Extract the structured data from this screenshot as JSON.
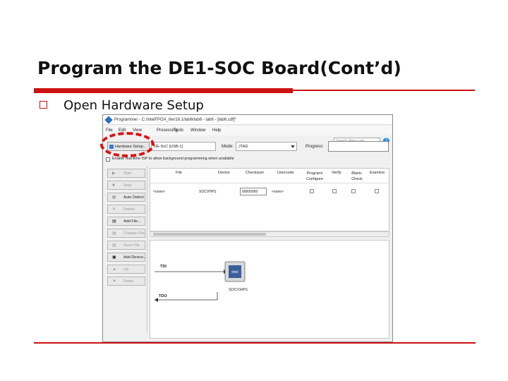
{
  "slide": {
    "title": "Program the DE1-SOC Board(Cont’d)",
    "bullet": "Open Hardware Setup"
  },
  "window": {
    "title": "Programmer - C:/intelFPGA_lite/18.1/lab6/lab6 - lab6 - [lab6.cdf]*",
    "menu": [
      "File",
      "Edit",
      "View",
      "Processing",
      "Tools",
      "Window",
      "Help"
    ],
    "search_placeholder": "Search altera.com",
    "help_label": "?"
  },
  "toolbar": {
    "hardware_setup_label": "Hardware Setup...",
    "hardware_value": "DE-SoC [USB-1]",
    "mode_label": "Mode:",
    "mode_value": "JTAG",
    "progress_label": "Progress:",
    "background_checkbox": "Enable real-time ISP to allow background programming when available"
  },
  "sidebar": {
    "buttons": [
      {
        "label": "Start",
        "icon": "start-icon",
        "glyph": "▶",
        "enabled": false
      },
      {
        "label": "Stop",
        "icon": "stop-icon",
        "glyph": "■",
        "enabled": false
      },
      {
        "label": "Auto Detect",
        "icon": "auto-detect-icon",
        "glyph": "◎",
        "enabled": true
      },
      {
        "label": "Delete",
        "icon": "delete-icon",
        "glyph": "✕",
        "enabled": false
      },
      {
        "label": "Add File...",
        "icon": "add-file-icon",
        "glyph": "▤",
        "enabled": true
      },
      {
        "label": "Change File...",
        "icon": "change-file-icon",
        "glyph": "▤",
        "enabled": false
      },
      {
        "label": "Save File",
        "icon": "save-file-icon",
        "glyph": "▤",
        "enabled": false
      },
      {
        "label": "Add Device...",
        "icon": "add-device-icon",
        "glyph": "▣",
        "enabled": true
      },
      {
        "label": "Up",
        "icon": "up-icon",
        "glyph": "▲",
        "enabled": false
      },
      {
        "label": "Down",
        "icon": "down-icon",
        "glyph": "▼",
        "enabled": false
      }
    ]
  },
  "table": {
    "headers": [
      "File",
      "Device",
      "Checksum",
      "Usercode",
      "Program/ Configure",
      "Verify",
      "Blank- Check",
      "Examine"
    ],
    "row": {
      "file": "<none>",
      "device": "SOCVHPS",
      "checksum": "00000000",
      "usercode": "<none>"
    }
  },
  "chain": {
    "device_label": "SOCVHPS",
    "tdi_label": "TDI",
    "tdo_label": "TDO"
  },
  "colors": {
    "accent_red": "#cc1111",
    "highlight_ring": "#dd1111"
  }
}
